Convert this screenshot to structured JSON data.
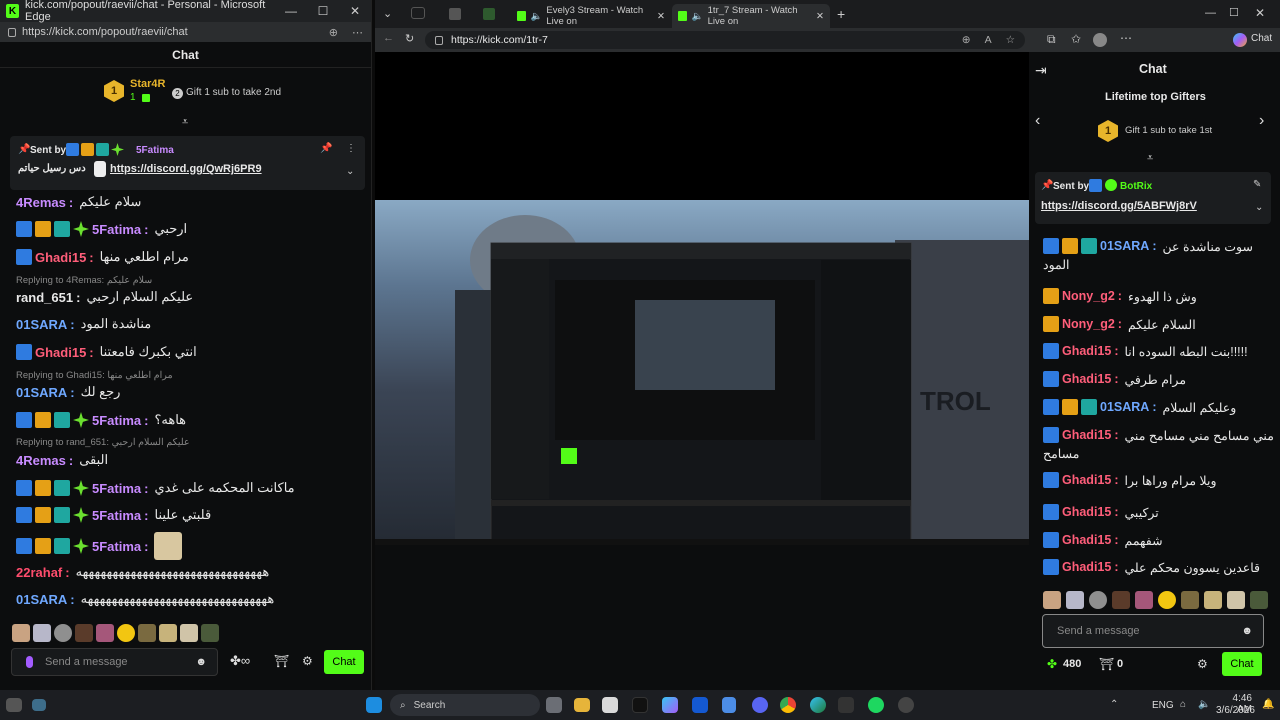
{
  "popup": {
    "title": "kick.com/popout/raevii/chat - Personal - Microsoft Edge",
    "url": "https://kick.com/popout/raevii/chat",
    "chat_header": "Chat",
    "top_gifter": {
      "rank": "1",
      "name": "Star4R",
      "count": "1"
    },
    "gift_prompt": "Gift 1 sub to take 2nd",
    "pinned": {
      "sent_by_label": "Sent by",
      "sender": "5Fatima",
      "text": "دس رسيل حياتم",
      "link": "https://discord.gg/QwRj6PR9"
    },
    "messages": [
      {
        "user": "4Remas",
        "color": "#c88bff",
        "text": "سلام عليكم",
        "badges": []
      },
      {
        "user": "5Fatima",
        "color": "#c88bff",
        "text": "ارحبي",
        "badges": [
          "blue",
          "crown",
          "teal",
          "star"
        ]
      },
      {
        "user": "Ghadi15",
        "color": "#ff5e7a",
        "text": "مرام اطلعي منها",
        "badges": [
          "blue"
        ]
      },
      {
        "reply": "Replying to 4Remas: سلام عليكم"
      },
      {
        "user": "rand_651",
        "color": "#e8e8e8",
        "text": "عليكم السلام ارحبي",
        "badges": []
      },
      {
        "user": "01SARA",
        "color": "#6fa8ff",
        "text": "مناشدة المود",
        "badges": []
      },
      {
        "user": "Ghadi15",
        "color": "#ff5e7a",
        "text": "انتي بكبرك فامعتنا",
        "badges": [
          "blue"
        ]
      },
      {
        "reply": "Replying to Ghadi15: مرام اطلعي منها"
      },
      {
        "user": "01SARA",
        "color": "#6fa8ff",
        "text": "رجع لك",
        "badges": []
      },
      {
        "user": "5Fatima",
        "color": "#c88bff",
        "text": "هاهه؟",
        "badges": [
          "blue",
          "crown",
          "teal",
          "star"
        ]
      },
      {
        "reply": "Replying to rand_651: عليكم السلام ارحبي"
      },
      {
        "user": "4Remas",
        "color": "#c88bff",
        "text": "البقى",
        "badges": []
      },
      {
        "user": "5Fatima",
        "color": "#c88bff",
        "text": "ماكانت المحكمه على غدي",
        "badges": [
          "blue",
          "crown",
          "teal",
          "star"
        ]
      },
      {
        "user": "5Fatima",
        "color": "#c88bff",
        "text": "قلبتي علينا",
        "badges": [
          "blue",
          "crown",
          "teal",
          "star"
        ]
      },
      {
        "user": "5Fatima",
        "color": "#c88bff",
        "text": "",
        "badges": [
          "blue",
          "crown",
          "teal",
          "star"
        ],
        "emote": true
      },
      {
        "user": "22rahaf",
        "color": "#ff4d6d",
        "text": "هههههههههههههههههههههههههههههههه",
        "badges": []
      },
      {
        "user": "01SARA",
        "color": "#6fa8ff",
        "text": "هههههههههههههههههههههههههههههههه",
        "badges": []
      }
    ],
    "send_placeholder": "Send a message",
    "chat_button": "Chat"
  },
  "browser": {
    "tabs": [
      {
        "label": "Evely3 Stream - Watch Live on"
      },
      {
        "label": "1tr_7 Stream - Watch Live on"
      }
    ],
    "url": "https://kick.com/1tr-7"
  },
  "right_chat": {
    "header": "Chat",
    "lifetime_label": "Lifetime top Gifters",
    "gifter_rank": "1",
    "gift_prompt": "Gift 1 sub to take 1st",
    "pinned": {
      "sent_by_label": "Sent by",
      "sender": "BotRix",
      "link": "https://discord.gg/5ABFWj8rV"
    },
    "messages": [
      {
        "user": "01SARA",
        "color": "#6fa8ff",
        "text": "سوت مناشدة عن",
        "cont": "المود",
        "badges": [
          "blue",
          "crown",
          "teal"
        ]
      },
      {
        "user": "Nony_g2",
        "color": "#ff5e7a",
        "text": "وش ذا الهدوء",
        "badges": [
          "crown"
        ]
      },
      {
        "user": "Nony_g2",
        "color": "#ff5e7a",
        "text": "السلام عليكم",
        "badges": [
          "crown"
        ]
      },
      {
        "user": "Ghadi15",
        "color": "#ff5e7a",
        "text": "بنت البطه السوده انا!!!!!",
        "badges": [
          "blue"
        ]
      },
      {
        "user": "Ghadi15",
        "color": "#ff5e7a",
        "text": "مرام طرفي",
        "badges": [
          "blue"
        ]
      },
      {
        "user": "01SARA",
        "color": "#6fa8ff",
        "text": "وعليكم السلام",
        "badges": [
          "blue",
          "crown",
          "teal"
        ]
      },
      {
        "user": "Ghadi15",
        "color": "#ff5e7a",
        "text": "مني مسامح مني مسامح مني",
        "cont": "مسامح",
        "badges": [
          "blue"
        ]
      },
      {
        "user": "Ghadi15",
        "color": "#ff5e7a",
        "text": "ويلا مرام وراها برا",
        "badges": [
          "blue"
        ]
      },
      {
        "user": "Ghadi15",
        "color": "#ff5e7a",
        "text": "تركيبي",
        "badges": [
          "blue"
        ]
      },
      {
        "user": "Ghadi15",
        "color": "#ff5e7a",
        "text": "شفهمم",
        "badges": [
          "blue"
        ]
      },
      {
        "user": "Ghadi15",
        "color": "#ff5e7a",
        "text": "قاعدين يسوون محكم علي",
        "badges": [
          "blue"
        ]
      }
    ],
    "send_placeholder": "Send a message",
    "kicks": "480",
    "gifts": "0",
    "chat_button": "Chat"
  },
  "taskbar": {
    "search": "Search",
    "lang": "ENG",
    "time": "4:46 AM",
    "date": "3/6/2026"
  },
  "colors": {
    "kick_green": "#53fc18",
    "bg": "#0c0d0e"
  }
}
